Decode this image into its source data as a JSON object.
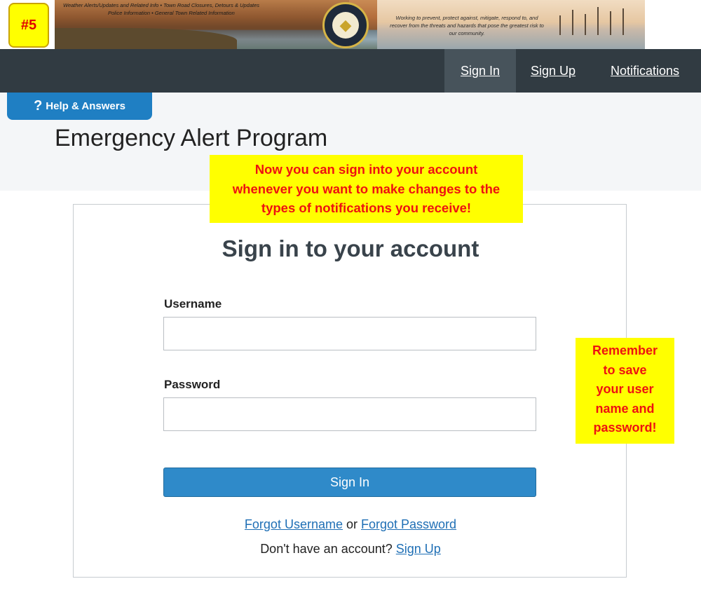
{
  "step_badge": "#5",
  "banner": {
    "links": [
      "Weather Alerts/Updates and Related Info  •  Town Road Closures, Detours & Updates",
      "Police Information  •  General Town Related Information"
    ],
    "mission": "Working to prevent, protect against, mitigate, respond to, and recover from the threats and hazards that pose the greatest risk to our community."
  },
  "nav": {
    "sign_in": "Sign In",
    "sign_up": "Sign Up",
    "notifications": "Notifications"
  },
  "help": {
    "icon": "?",
    "label": "Help & Answers"
  },
  "page_title": "Emergency Alert Program",
  "callouts": {
    "top": [
      "Now you can sign into your account",
      "whenever you want to make changes to the",
      "types of notifications you receive!"
    ],
    "right": [
      "Remember",
      "to save",
      "your user",
      "name and",
      "password!"
    ]
  },
  "signin_form": {
    "title": "Sign in to your account",
    "username_label": "Username",
    "username_value": "",
    "password_label": "Password",
    "password_value": "",
    "submit_label": "Sign In",
    "forgot_username": "Forgot Username",
    "or_text": " or ",
    "forgot_password": "Forgot Password",
    "no_account_text": "Don't have an account? ",
    "sign_up_link": "Sign Up"
  },
  "colors": {
    "nav_bg": "#313b42",
    "nav_active": "#47535b",
    "accent_blue": "#2f8ac9",
    "help_blue": "#1f7fc3",
    "callout_bg": "#ffff00",
    "callout_text": "#ee1111"
  }
}
